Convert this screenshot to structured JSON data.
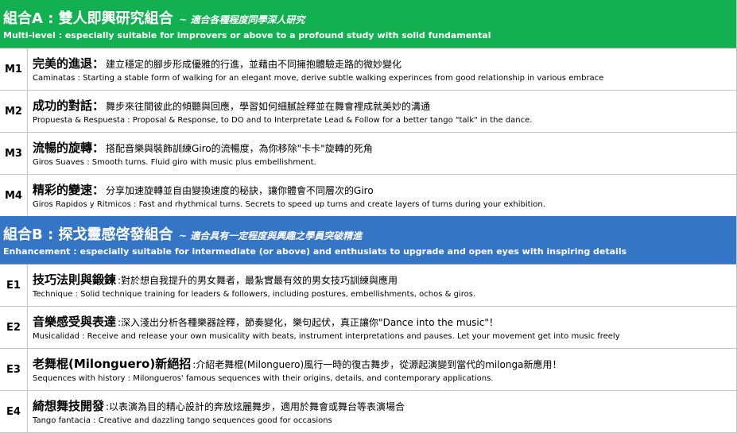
{
  "section_a": {
    "title": "組合A : 雙人即興研究組合",
    "subtitle": "~ 適合各種程度同學深人研究",
    "desc": "Multi-level : especially suitable for improvers or above to a profound study  with solid fundamental",
    "color": "#12b050",
    "items": [
      {
        "code": "M1",
        "title": "完美的進退：",
        "zh": "建立穩定的腳步形成優雅的行進，並藉由不同擁抱體驗走路的微妙變化",
        "en": "Caminatas : Starting a stable form of walking for an elegant move, derive subtle walking experinces from good relationship in various embrace"
      },
      {
        "code": "M2",
        "title": "成功的對話：",
        "zh": "舞步來往間彼此的傾聽與回應，學習如何細膩詮釋並在舞會裡成就美妙的溝通",
        "en": "Propuesta & Respuesta : Proposal & Response, to DO and to Interpretate Lead & Follow for a better tango \"talk\" in the dance."
      },
      {
        "code": "M3",
        "title": "流暢的旋轉：",
        "zh": "搭配音樂與裝飾訓練Giro的流暢度，為你移除\"卡卡\"旋轉的死角",
        "en": "Giros Suaves : Smooth turns. Fluid giro with music plus embellishment."
      },
      {
        "code": "M4",
        "title": "精彩的變速：",
        "zh": "分享加速旋轉並自由變換速度的秘訣，讓你體會不同層次的Giro",
        "en": "Giros Rapidos y Ritmicos : Fast and rhythmical turns. Secrets to speed up turns and create layers of turns during your exhibition."
      }
    ]
  },
  "section_b": {
    "title": "組合B : 探戈靈感啓發組合",
    "subtitle": "~ 適合具有一定程度與興趣之學員突破精進",
    "desc": "Enhancement : especially suitable for intermediate (or above) and enthusiats to upgrade and open eyes with inspiring details",
    "color": "#3575c6",
    "items": [
      {
        "code": "E1",
        "title": "技巧法則與鍛鍊",
        "zh": ":對於想自我提升的男女舞者，最紮實最有效的男女技巧訓練與應用",
        "en": "Technique : Solid technique training for leaders & followers, including postures, embellishments, ochos & giros."
      },
      {
        "code": "E2",
        "title": "音樂感受與表達",
        "zh": ":深入淺出分析各種樂器詮釋，節奏變化，樂句起伏，真正讓你\"Dance into the music\"！",
        "en": "Musicalidad : Receive and release your own musicality  with beats, instrument interpretations and pauses. Let your movement get into music freely"
      },
      {
        "code": "E3",
        "title": "老舞棍(Milonguero)新絕招",
        "zh": ":介紹老舞棍(Milonguero)風行一時的復古舞步，從源起演變到當代的milonga新應用！",
        "en": "Sequences with history : Milongueros' famous sequences with their origins, details, and contemporary applications."
      },
      {
        "code": "E4",
        "title": "綺想舞技開發",
        "zh": ":以表演為目的精心設計的奔放炫麗舞步，適用於舞會或舞台等表演場合",
        "en": "Tango fantacia : Creative and dazzling tango sequences good for occasions"
      }
    ]
  }
}
